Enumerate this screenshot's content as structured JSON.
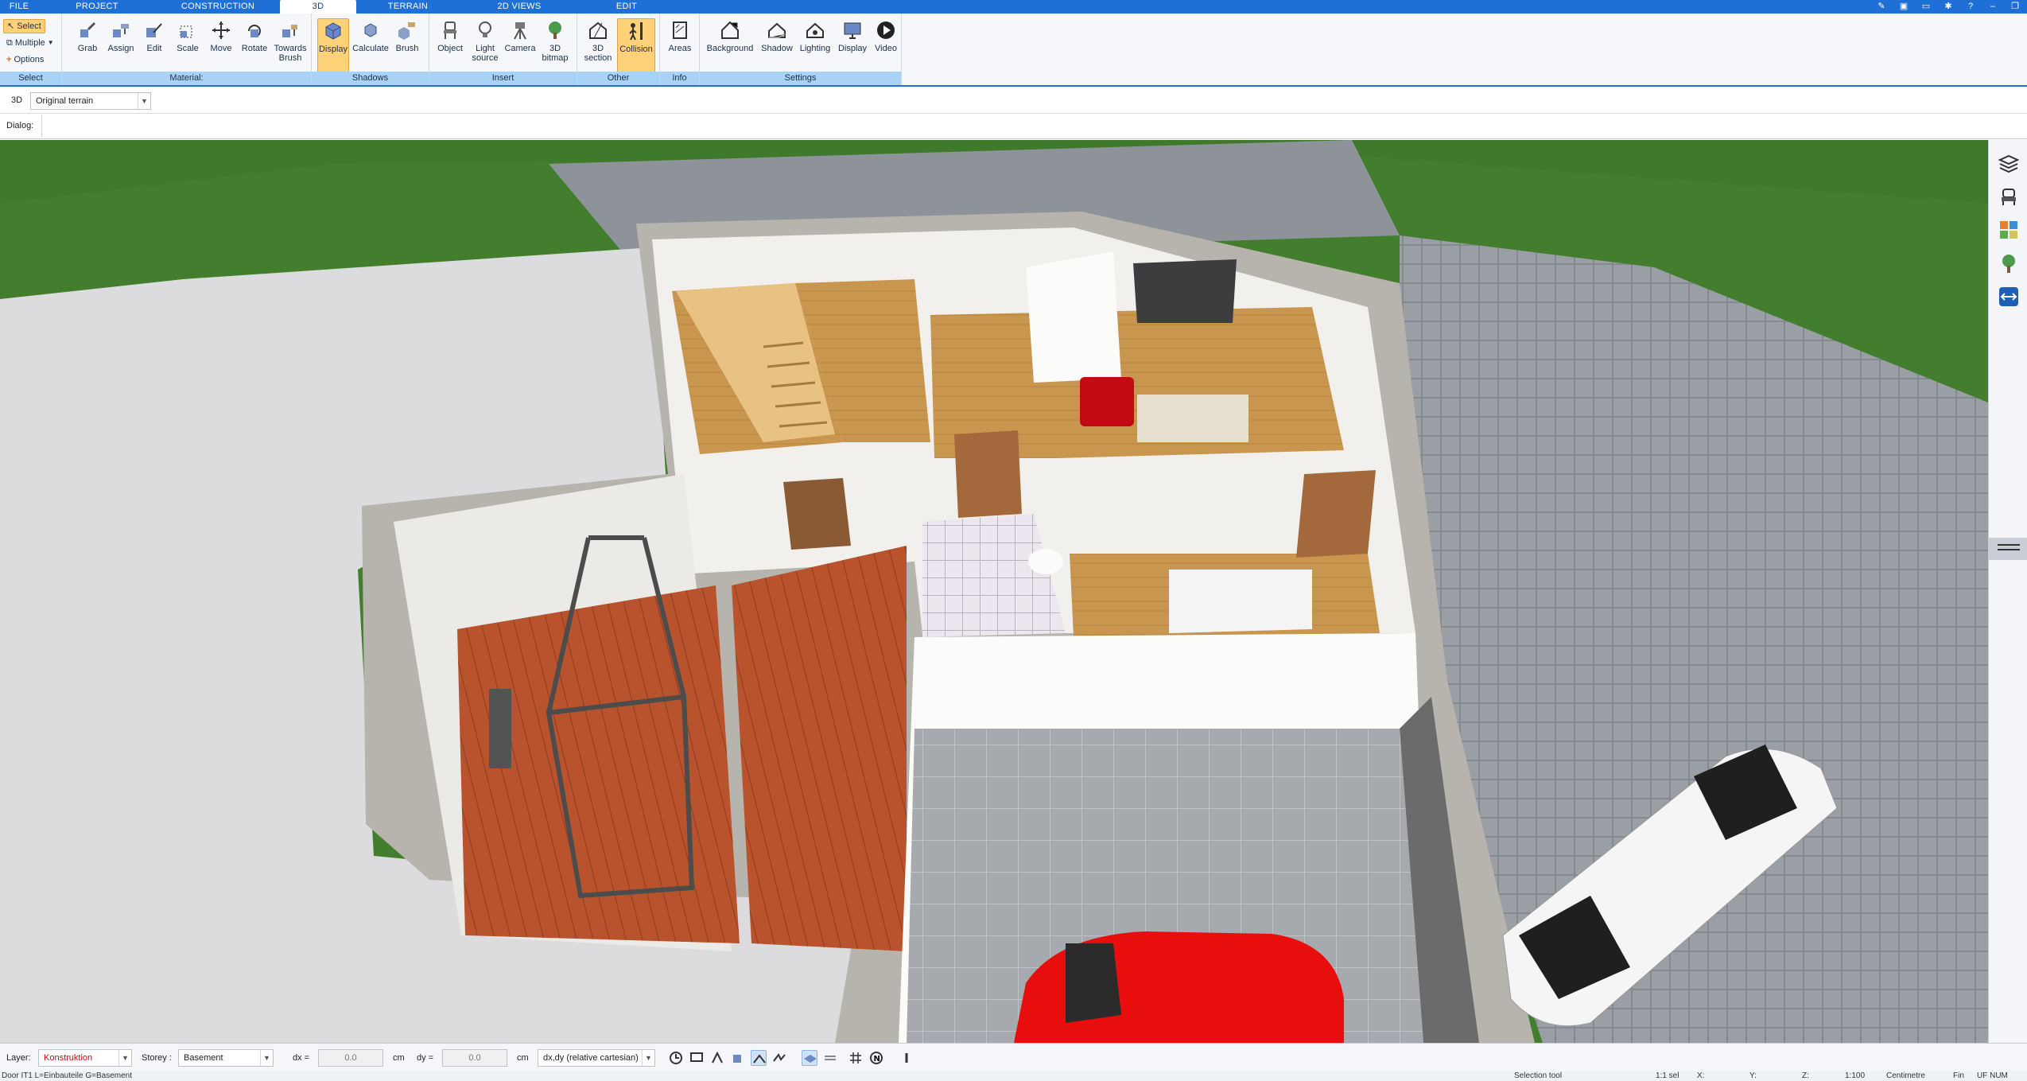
{
  "tabs": [
    "FILE",
    "PROJECT",
    "CONSTRUCTION",
    "3D",
    "TERRAIN",
    "2D VIEWS",
    "EDIT"
  ],
  "active_tab": "3D",
  "ribbon": {
    "select_group": {
      "label": "Select",
      "select": "Select",
      "multiple": "Multiple",
      "options": "Options"
    },
    "material_group": {
      "label": "Material:",
      "buttons": [
        "Grab",
        "Assign",
        "Edit",
        "Scale",
        "Move",
        "Rotate",
        "Towards",
        "Brush"
      ]
    },
    "shadows_group": {
      "label": "Shadows",
      "buttons": [
        "Display",
        "Calculate",
        "Brush"
      ]
    },
    "insert_group": {
      "label": "Insert",
      "buttons": [
        "Object",
        "Light",
        "source",
        "Camera",
        "3D",
        "bitmap"
      ]
    },
    "other_group": {
      "label": "Other",
      "buttons": [
        "3D",
        "section",
        "Collision"
      ]
    },
    "info_group": {
      "label": "Info",
      "buttons": [
        "Areas"
      ]
    },
    "settings_group": {
      "label": "Settings",
      "buttons": [
        "Background",
        "Shadow",
        "Lighting",
        "Display",
        "Video"
      ]
    }
  },
  "row2": {
    "view_label": "3D",
    "terrain_select": "Original terrain"
  },
  "row3": {
    "dialog_label": "Dialog:"
  },
  "bottom": {
    "layer_label": "Layer:",
    "layer_value": "Konstruktion",
    "storey_label": "Storey :",
    "storey_value": "Basement",
    "dx_label": "dx =",
    "dx_value": "0.0",
    "dx_unit": "cm",
    "dy_label": "dy =",
    "dy_value": "0.0",
    "dy_unit": "cm",
    "coord_mode": "dx,dy (relative cartesian)"
  },
  "status": {
    "left": "Door IT1 L=Einbauteile G=Basement",
    "tool": "Selection tool",
    "sel": "1:1 sel",
    "x": "X:",
    "y": "Y:",
    "z": "Z:",
    "scale": "1:100",
    "unit": "Centimetre",
    "fin": "Fin",
    "flags": "UF NUM"
  },
  "colors": {
    "accent": "#1e6fd6",
    "ribbon_label": "#a9d2f7",
    "active_button": "#ffd27a"
  }
}
